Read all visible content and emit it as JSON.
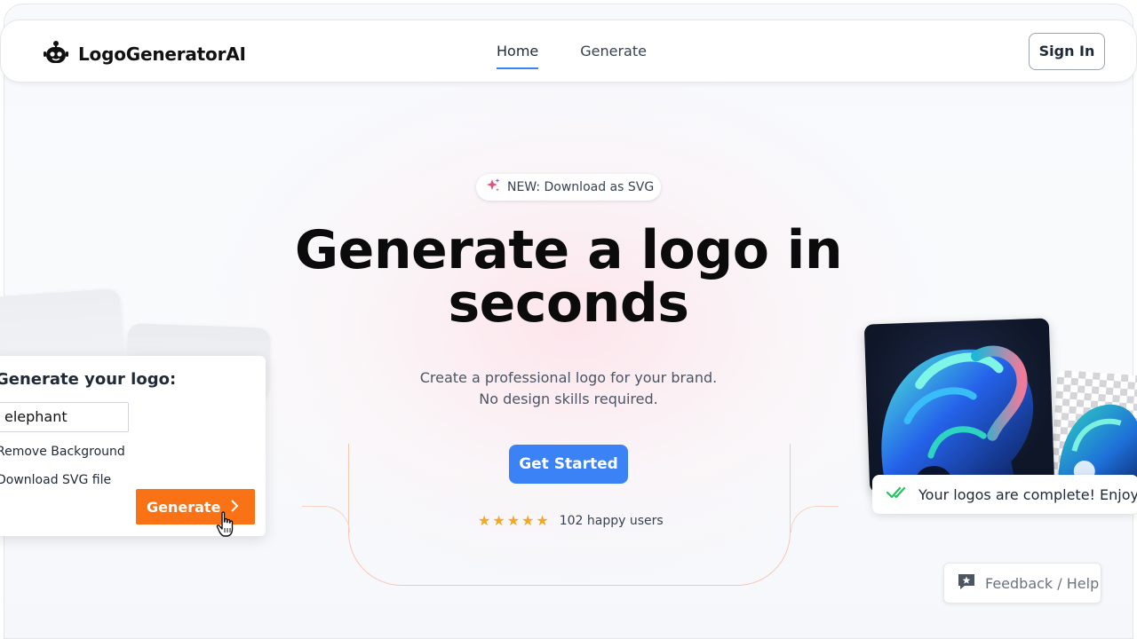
{
  "header": {
    "brand_name": "LogoGeneratorAI",
    "nav": [
      {
        "label": "Home",
        "active": true
      },
      {
        "label": "Generate",
        "active": false
      }
    ],
    "sign_in_label": "Sign In"
  },
  "hero": {
    "badge_text": "NEW: Download as SVG",
    "headline_line1": "Generate a logo in",
    "headline_line2": "seconds",
    "sub_line1": "Create a professional logo for your brand.",
    "sub_line2": "No design skills required.",
    "cta_label": "Get Started",
    "stars": "★★★★★",
    "rating_text": "102 happy users"
  },
  "demo_card": {
    "title": "Generate your logo:",
    "input_value": "elephant",
    "option_1": "Remove Background",
    "option_2": "Download SVG file",
    "button_label": "Generate"
  },
  "toast": {
    "text": "Your logos are complete! Enjoy"
  },
  "feedback": {
    "label": "Feedback / Help"
  },
  "colors": {
    "accent": "#3b82f6",
    "generate_button": "#f97316",
    "stars": "#f5a623"
  }
}
